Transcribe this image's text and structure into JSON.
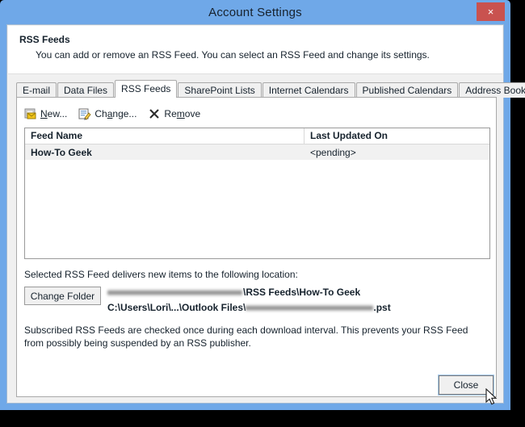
{
  "window": {
    "title": "Account Settings",
    "close_x_icon": "close-icon",
    "close_x_label": "×"
  },
  "header": {
    "title": "RSS Feeds",
    "subtitle": "You can add or remove an RSS Feed. You can select an RSS Feed and change its settings."
  },
  "tabs": [
    {
      "label": "E-mail",
      "active": false
    },
    {
      "label": "Data Files",
      "active": false
    },
    {
      "label": "RSS Feeds",
      "active": true
    },
    {
      "label": "SharePoint Lists",
      "active": false
    },
    {
      "label": "Internet Calendars",
      "active": false
    },
    {
      "label": "Published Calendars",
      "active": false
    },
    {
      "label": "Address Books",
      "active": false
    }
  ],
  "toolbar": {
    "new": {
      "pre": "",
      "accel": "N",
      "post": "ew...",
      "icon": "new-feed-icon"
    },
    "change": {
      "pre": "Ch",
      "accel": "a",
      "post": "nge...",
      "icon": "change-feed-icon"
    },
    "remove": {
      "pre": "Re",
      "accel": "m",
      "post": "ove",
      "icon": "remove-x-icon"
    }
  },
  "list": {
    "columns": [
      "Feed Name",
      "Last Updated On"
    ],
    "rows": [
      {
        "feed_name": "How-To Geek",
        "last_updated_on": "<pending>",
        "selected": true
      }
    ]
  },
  "location": {
    "label": "Selected RSS Feed delivers new items to the following location:",
    "change_folder_button": "Change Folder",
    "path_line1_redacted": true,
    "path_line1_suffix": "\\RSS Feeds\\How-To Geek",
    "path_line2_prefix": "C:\\Users\\Lori\\...\\Outlook Files\\",
    "path_line2_redacted": true,
    "path_line2_suffix": ".pst"
  },
  "footer_note": "Subscribed RSS Feeds are checked once during each download interval. This prevents your RSS Feed from possibly being suspended by an RSS publisher.",
  "buttons": {
    "close": "Close"
  },
  "colors": {
    "window_frame": "#6fa8e8",
    "close_button_red": "#c9524f",
    "client_bg": "#f0f0f0",
    "panel_white": "#ffffff",
    "selected_row": "#f1f1f1",
    "text": "#16222d"
  }
}
